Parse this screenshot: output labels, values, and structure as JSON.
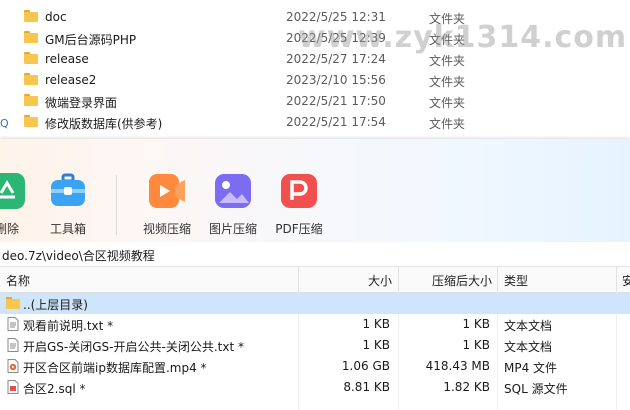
{
  "explorer": {
    "rows": [
      {
        "name": "doc",
        "date": "2022/5/25 12:31",
        "type": "文件夹"
      },
      {
        "name": "GM后台源码PHP",
        "date": "2022/5/25 12:39",
        "type": "文件夹"
      },
      {
        "name": "release",
        "date": "2022/5/27 17:24",
        "type": "文件夹"
      },
      {
        "name": "release2",
        "date": "2023/2/10 15:56",
        "type": "文件夹"
      },
      {
        "name": "微端登录界面",
        "date": "2022/5/21 17:50",
        "type": "文件夹"
      },
      {
        "name": "修改版数据库(供参考)",
        "date": "2022/5/21 17:54",
        "type": "文件夹"
      }
    ],
    "left_glyph": "Q",
    "watermark": "www.zyk1314.com"
  },
  "toolbar": {
    "items": [
      {
        "label": "删除",
        "icon": "recycle-icon"
      },
      {
        "label": "工具箱",
        "icon": "toolbox-icon"
      },
      {
        "label": "视频压缩",
        "icon": "video-compress-icon"
      },
      {
        "label": "图片压缩",
        "icon": "image-compress-icon"
      },
      {
        "label": "PDF压缩",
        "icon": "pdf-compress-icon"
      }
    ]
  },
  "path": "deo.7z\\video\\合区视频教程",
  "columns": {
    "name": "名称",
    "size": "大小",
    "packed": "压缩后大小",
    "type": "类型",
    "extra": "安"
  },
  "files": [
    {
      "name": "..(上层目录)",
      "size": "",
      "packed": "",
      "type": "",
      "icon": "folder-icon"
    },
    {
      "name": "观看前说明.txt *",
      "size": "1 KB",
      "packed": "1 KB",
      "type": "文本文档",
      "icon": "text-file-icon"
    },
    {
      "name": "开启GS-关闭GS-开启公共-关闭公共.txt *",
      "size": "1 KB",
      "packed": "1 KB",
      "type": "文本文档",
      "icon": "text-file-icon"
    },
    {
      "name": "开区合区前端ip数据库配置.mp4 *",
      "size": "1.06 GB",
      "packed": "418.43 MB",
      "type": "MP4 文件",
      "icon": "video-file-icon"
    },
    {
      "name": "合区2.sql *",
      "size": "8.81 KB",
      "packed": "1.82 KB",
      "type": "SQL 源文件",
      "icon": "sql-file-icon"
    }
  ],
  "colors": {
    "folder": "#f7c64f",
    "selection": "#cfe5fb",
    "video_icon": "#ff8a3d",
    "image_icon": "#7c6cf0",
    "pdf_icon": "#f24f4f",
    "recycle_icon": "#2bb673",
    "toolbox_icon": "#2f9cf0"
  }
}
